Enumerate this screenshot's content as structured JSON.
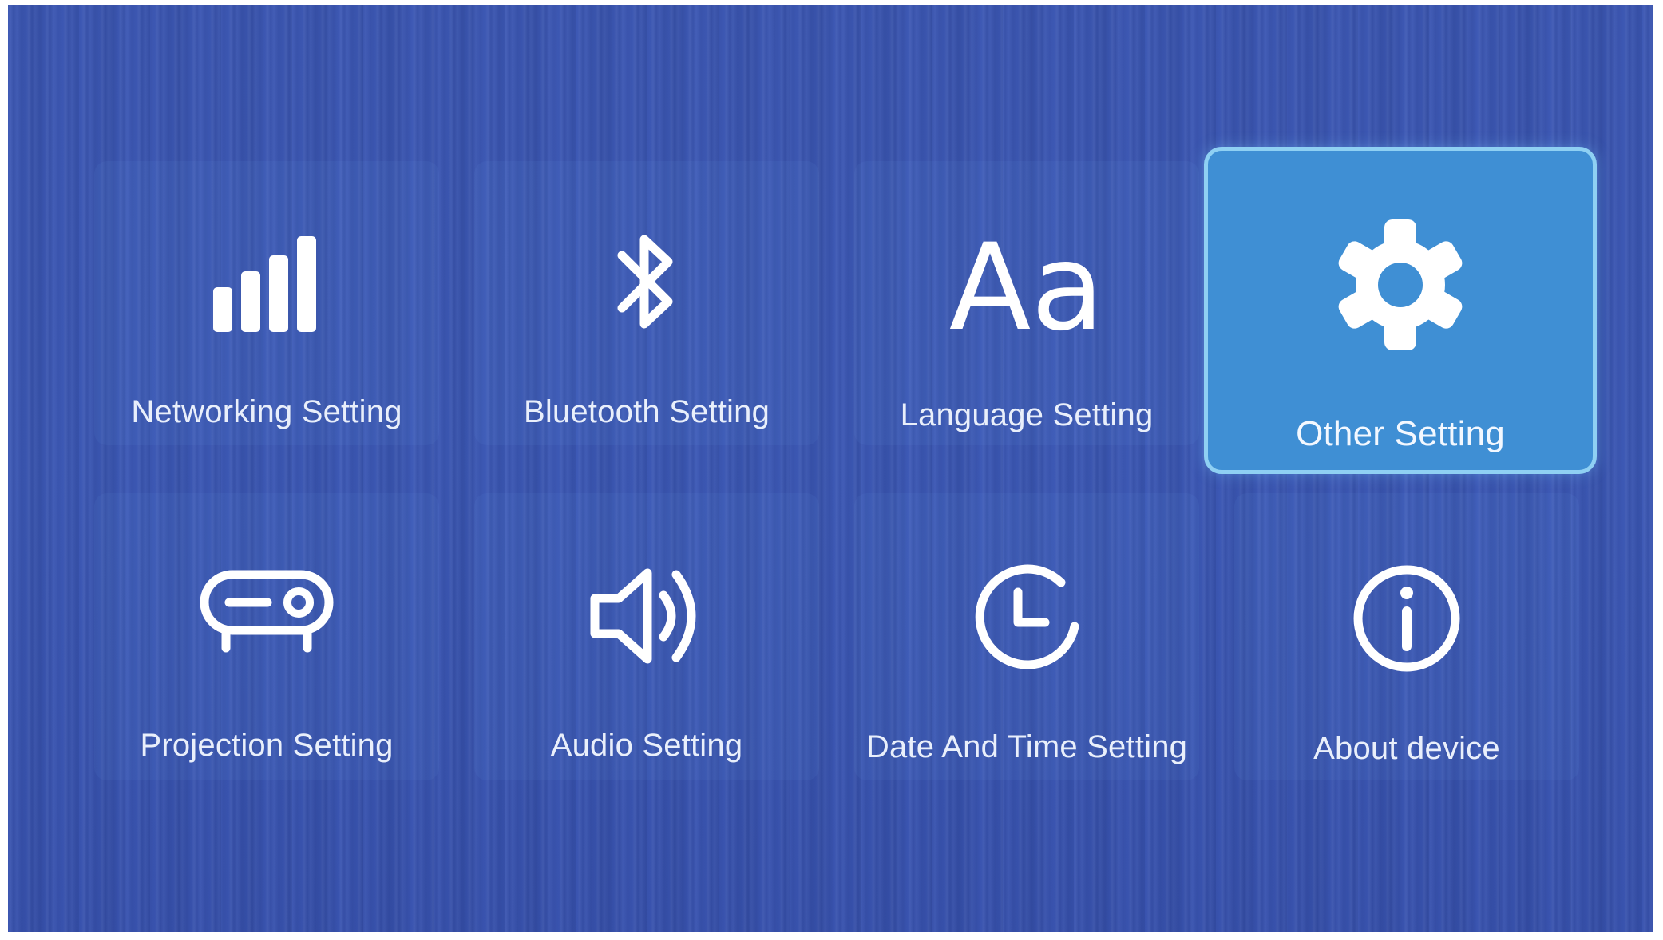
{
  "menu": {
    "selected": "Other Setting",
    "items": [
      {
        "id": "networking",
        "label": "Networking Setting",
        "icon": "signal-bars-icon"
      },
      {
        "id": "bluetooth",
        "label": "Bluetooth Setting",
        "icon": "bluetooth-icon"
      },
      {
        "id": "language",
        "label": "Language Setting",
        "icon": "font-aa-icon"
      },
      {
        "id": "other",
        "label": "Other Setting",
        "icon": "gear-icon"
      },
      {
        "id": "projection",
        "label": "Projection Setting",
        "icon": "projector-icon"
      },
      {
        "id": "audio",
        "label": "Audio Setting",
        "icon": "speaker-icon"
      },
      {
        "id": "datetime",
        "label": "Date And Time Setting",
        "icon": "clock-icon"
      },
      {
        "id": "about",
        "label": "About device",
        "icon": "info-icon"
      }
    ],
    "language_icon_text": "Aa"
  },
  "colors": {
    "background": "#3a55b0",
    "selected_tile": "#3f8fd4",
    "selected_border": "#8fd0f3",
    "icon": "#ffffff"
  }
}
